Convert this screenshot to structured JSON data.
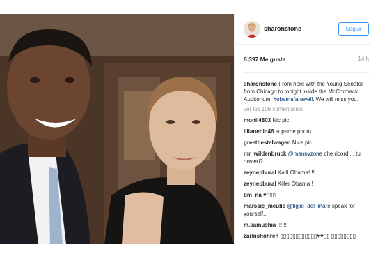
{
  "post": {
    "username": "sharonstone",
    "follow_label": "Seguir",
    "likes": "8.397 Me gusta",
    "time_ago": "14 h",
    "caption": {
      "username": "sharonstone",
      "text": "From here with the Young Senator from Chicago to tonight inside the McCormack Auditorium.",
      "hashtag": "#obamafarewell",
      "text2": ". We will miss you."
    },
    "view_all_comments": "ver los 106 comentarios",
    "comments": [
      {
        "user": "monil4803",
        "text": "Nic pic"
      },
      {
        "user": "lilianebld46",
        "text": "superbe photo"
      },
      {
        "user": "greethestelwagen",
        "text": "Nice pic"
      },
      {
        "user": "mr_wildenbruck",
        "mention": "@mannyzone",
        "text": "che ricordi... tu dov'eri?"
      },
      {
        "user": "zeynepbural",
        "text": "Katil Obama! !!"
      },
      {
        "user": "zeynepbural",
        "text": "Killer Obama !"
      },
      {
        "user": "bm_na",
        "text": "♥▯▯▯"
      },
      {
        "user": "marssie_meulie",
        "mention": "@figlio_del_mare",
        "text": "speak for yourself..."
      },
      {
        "user": "m.samushia",
        "text": "!!!!!!"
      },
      {
        "user": "zarinshohreh",
        "text": "▯▯▯▯▯▯▯▯▯▯▯▯♥♥▯▯ ▯▯▯▯▯▯▯▯"
      }
    ]
  },
  "colors": {
    "accent": "#3897f0",
    "hashtag": "#003569",
    "muted": "#999999",
    "text": "#262626"
  }
}
